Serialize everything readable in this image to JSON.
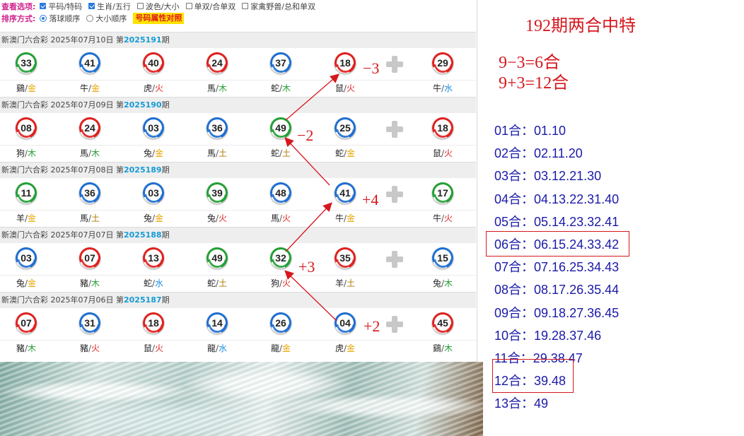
{
  "options": {
    "label": "查看选项:",
    "items": [
      {
        "text": "平码/特码",
        "checked": true
      },
      {
        "text": "生肖/五行",
        "checked": true
      },
      {
        "text": "波色/大小",
        "checked": false
      },
      {
        "text": "单双/合单双",
        "checked": false
      },
      {
        "text": "家禽野兽/总和单双",
        "checked": false
      }
    ]
  },
  "sort": {
    "label": "排序方式:",
    "items": [
      {
        "text": "落球顺序",
        "selected": true
      },
      {
        "text": "大小顺序",
        "selected": false
      }
    ],
    "button": "号码属性对照"
  },
  "draws": [
    {
      "prefix": "新澳门六合彩 2025年07月10日 第",
      "period": "2025191",
      "suffix": "期",
      "balls": [
        {
          "n": "33",
          "c": "green",
          "z": "鷄",
          "e": "金"
        },
        {
          "n": "41",
          "c": "blue",
          "z": "牛",
          "e": "金"
        },
        {
          "n": "40",
          "c": "red",
          "z": "虎",
          "e": "火"
        },
        {
          "n": "24",
          "c": "red",
          "z": "馬",
          "e": "木"
        },
        {
          "n": "37",
          "c": "blue",
          "z": "蛇",
          "e": "木"
        },
        {
          "n": "18",
          "c": "red",
          "z": "鼠",
          "e": "火"
        },
        {
          "n": "29",
          "c": "red",
          "z": "牛",
          "e": "水"
        }
      ]
    },
    {
      "prefix": "新澳门六合彩 2025年07月09日 第",
      "period": "2025190",
      "suffix": "期",
      "balls": [
        {
          "n": "08",
          "c": "red",
          "z": "狗",
          "e": "木"
        },
        {
          "n": "24",
          "c": "red",
          "z": "馬",
          "e": "木"
        },
        {
          "n": "03",
          "c": "blue",
          "z": "兔",
          "e": "金"
        },
        {
          "n": "36",
          "c": "blue",
          "z": "馬",
          "e": "土"
        },
        {
          "n": "49",
          "c": "green",
          "z": "蛇",
          "e": "土"
        },
        {
          "n": "25",
          "c": "blue",
          "z": "蛇",
          "e": "金"
        },
        {
          "n": "18",
          "c": "red",
          "z": "鼠",
          "e": "火"
        }
      ]
    },
    {
      "prefix": "新澳门六合彩 2025年07月08日 第",
      "period": "2025189",
      "suffix": "期",
      "balls": [
        {
          "n": "11",
          "c": "green",
          "z": "羊",
          "e": "金"
        },
        {
          "n": "36",
          "c": "blue",
          "z": "馬",
          "e": "土"
        },
        {
          "n": "03",
          "c": "blue",
          "z": "兔",
          "e": "金"
        },
        {
          "n": "39",
          "c": "green",
          "z": "兔",
          "e": "火"
        },
        {
          "n": "48",
          "c": "blue",
          "z": "馬",
          "e": "火"
        },
        {
          "n": "41",
          "c": "blue",
          "z": "牛",
          "e": "金"
        },
        {
          "n": "17",
          "c": "green",
          "z": "牛",
          "e": "火"
        }
      ]
    },
    {
      "prefix": "新澳门六合彩 2025年07月07日 第",
      "period": "2025188",
      "suffix": "期",
      "balls": [
        {
          "n": "03",
          "c": "blue",
          "z": "兔",
          "e": "金"
        },
        {
          "n": "07",
          "c": "red",
          "z": "豬",
          "e": "木"
        },
        {
          "n": "13",
          "c": "red",
          "z": "蛇",
          "e": "水"
        },
        {
          "n": "49",
          "c": "green",
          "z": "蛇",
          "e": "土"
        },
        {
          "n": "32",
          "c": "green",
          "z": "狗",
          "e": "火"
        },
        {
          "n": "35",
          "c": "red",
          "z": "羊",
          "e": "土"
        },
        {
          "n": "15",
          "c": "blue",
          "z": "兔",
          "e": "木"
        }
      ]
    },
    {
      "prefix": "新澳门六合彩 2025年07月06日 第",
      "period": "2025187",
      "suffix": "期",
      "balls": [
        {
          "n": "07",
          "c": "red",
          "z": "豬",
          "e": "木"
        },
        {
          "n": "31",
          "c": "blue",
          "z": "豬",
          "e": "火"
        },
        {
          "n": "18",
          "c": "red",
          "z": "鼠",
          "e": "火"
        },
        {
          "n": "14",
          "c": "blue",
          "z": "龍",
          "e": "水"
        },
        {
          "n": "26",
          "c": "blue",
          "z": "龍",
          "e": "金"
        },
        {
          "n": "04",
          "c": "blue",
          "z": "虎",
          "e": "金"
        },
        {
          "n": "45",
          "c": "red",
          "z": "鷄",
          "e": "木"
        }
      ]
    }
  ],
  "annotations": {
    "offsets": [
      "−3",
      "−2",
      "+4",
      "+3",
      "+2"
    ]
  },
  "right": {
    "title": "192期两合中特",
    "calc": [
      "9−3=6合",
      "9+3=12合"
    ],
    "he_list": [
      "01合：01.10",
      "02合：02.11.20",
      "03合：03.12.21.30",
      "04合：04.13.22.31.40",
      "05合：05.14.23.32.41",
      "06合：06.15.24.33.42",
      "07合：07.16.25.34.43",
      "08合：08.17.26.35.44",
      "09合：09.18.27.36.45",
      "10合：19.28.37.46",
      "11合：29.38.47",
      "12合：39.48",
      "13合：49"
    ],
    "highlight_color": "#d6181e",
    "text_color": "#1a1aa8"
  }
}
